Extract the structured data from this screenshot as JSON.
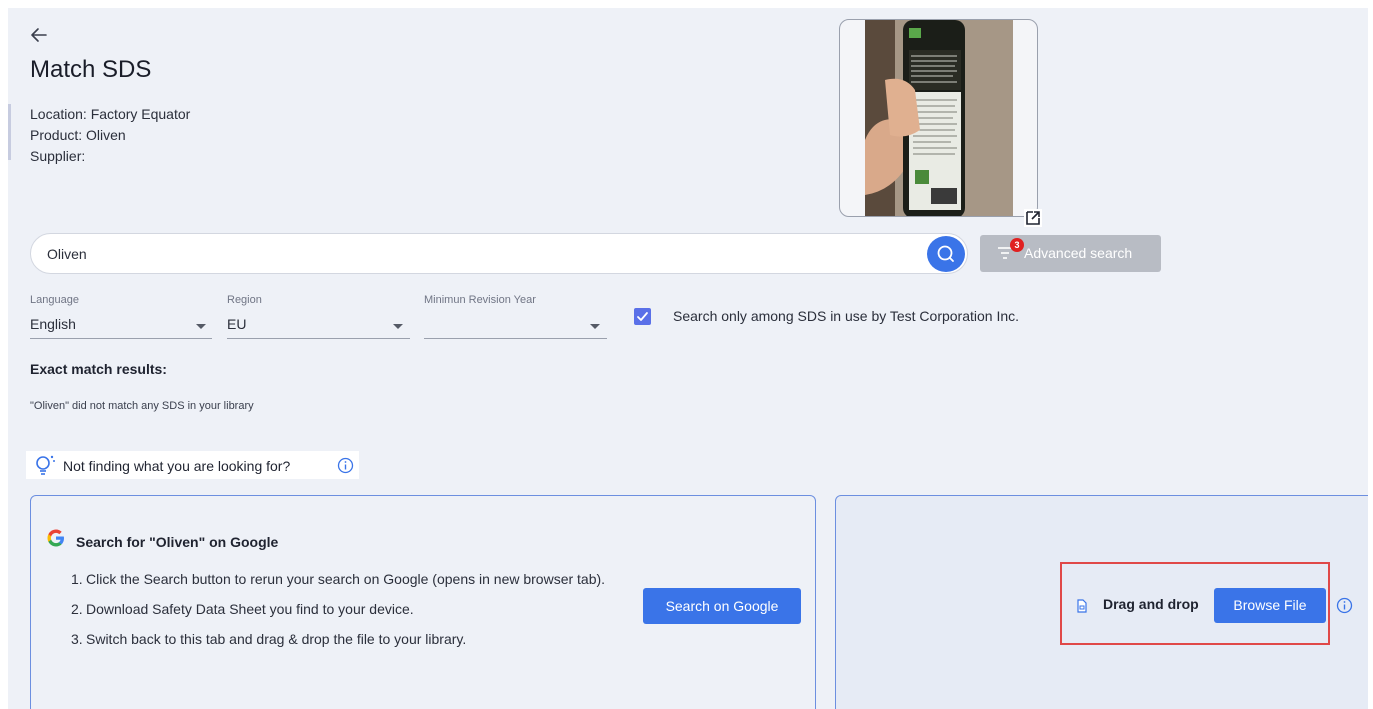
{
  "page": {
    "title": "Match SDS"
  },
  "meta": {
    "location": "Location: Factory Equator",
    "product": "Product: Oliven",
    "supplier": "Supplier:"
  },
  "search": {
    "value": "Oliven",
    "placeholder": ""
  },
  "advanced": {
    "label": "Advanced search",
    "badge": "3"
  },
  "filters": {
    "language": {
      "label": "Language",
      "value": "English"
    },
    "region": {
      "label": "Region",
      "value": "EU"
    },
    "year": {
      "label": "Minimun Revision Year",
      "value": ""
    }
  },
  "only_in_use": {
    "label": "Search only among SDS in use by Test Corporation Inc.",
    "checked": true
  },
  "results": {
    "heading": "Exact match results:",
    "no_match": "\"Oliven\" did not match any SDS in your library"
  },
  "hint": {
    "text": "Not finding what you are looking for?"
  },
  "google": {
    "title": "Search for \"Oliven\" on Google",
    "steps": [
      {
        "num": "1.",
        "text": "Click the Search button to rerun your search on Google (opens in new browser tab)."
      },
      {
        "num": "2.",
        "text": "Download Safety Data Sheet you find to your device."
      },
      {
        "num": "3.",
        "text": "Switch back to this tab and drag & drop the file to your library."
      }
    ],
    "button": "Search on Google"
  },
  "upload": {
    "drag_label": "Drag and drop",
    "browse_button": "Browse File"
  },
  "colors": {
    "accent": "#3a74e8",
    "highlight": "#e04848",
    "badge": "#e02020",
    "card_border": "#6c8fe0"
  }
}
